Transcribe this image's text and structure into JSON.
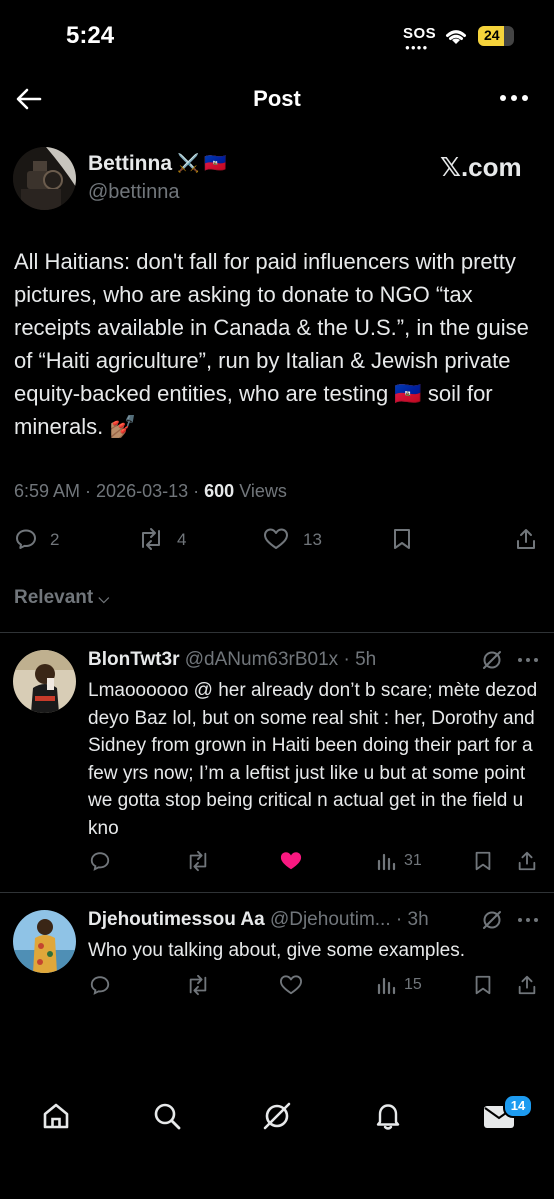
{
  "status_bar": {
    "time": "5:24",
    "sos": "SOS",
    "battery": "24"
  },
  "header": {
    "title": "Post"
  },
  "post": {
    "author_name": "Bettinna",
    "author_emoji": "⚔️ 🇭🇹",
    "handle": "@bettinna",
    "source": "𝕏.com",
    "text": "All Haitians: don't fall for paid influencers with pretty pictures, who are asking to donate to NGO “tax receipts available in Canada & the U.S.”, in the guise of “Haiti agriculture”, run by Italian & Jewish private equity-backed entities, who are testing 🇭🇹 soil for minerals. 💅🏽",
    "time": "6:59 AM",
    "date": "2026-03-13",
    "views_count": "600",
    "views_label": "Views",
    "replies": "2",
    "reposts": "4",
    "likes": "13"
  },
  "sort": {
    "label": "Relevant"
  },
  "replies": [
    {
      "name": "BlonTwt3r",
      "handle": "@dANum63rB01x",
      "age": "5h",
      "text": "Lmaoooooo @ her already don’t b scare; mète dezod deyo Baz lol, but on some real shit : her, Dorothy and Sidney from grown in Haiti been doing their part for a few yrs now; I’m a leftist just like u but at some point we gotta stop being critical n actual get in the field u kno",
      "views": "31",
      "liked": true
    },
    {
      "name": "Djehoutimessou Aa",
      "handle": "@Djehoutim...",
      "age": "3h",
      "text": "Who you talking about, give some examples.",
      "views": "15",
      "liked": false
    }
  ],
  "nav": {
    "badge": "14"
  },
  "colors": {
    "background": "#000000",
    "text": "#e7e9ea",
    "muted": "#71767b",
    "like": "#f91880",
    "accent": "#1d9bf0"
  }
}
